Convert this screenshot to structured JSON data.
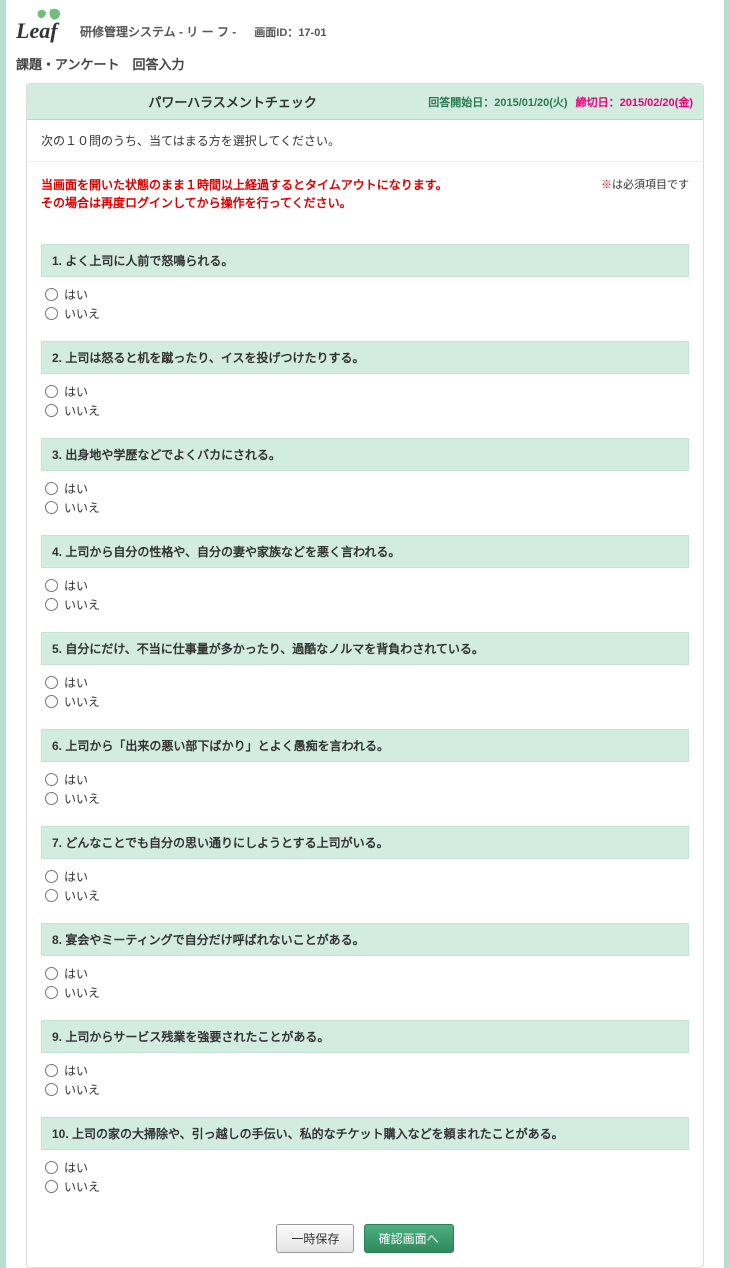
{
  "header": {
    "system_name": "研修管理システム  - リ ー フ -",
    "screen_id_label": "画面ID：",
    "screen_id": "17-01",
    "breadcrumb": "課題・アンケート　回答入力"
  },
  "titlebar": {
    "title": "パワーハラスメントチェック",
    "start_label": "回答開始日：",
    "start_value": "2015/01/20(火)",
    "deadline_label": "締切日：",
    "deadline_value": "2015/02/20(金)"
  },
  "instruction": "次の１０問のうち、当てはまる方を選択してください。",
  "timeout_warning_l1": "当画面を開いた状態のまま１時間以上経過するとタイムアウトになります。",
  "timeout_warning_l2": "その場合は再度ログインしてから操作を行ってください。",
  "required_note": "は必須項目です",
  "required_asterisk": "※",
  "option_yes": "はい",
  "option_no": "いいえ",
  "questions": [
    {
      "num": "1.",
      "text": "よく上司に人前で怒鳴られる。"
    },
    {
      "num": "2.",
      "text": "上司は怒ると机を蹴ったり、イスを投げつけたりする。"
    },
    {
      "num": "3.",
      "text": "出身地や学歴などでよくバカにされる。"
    },
    {
      "num": "4.",
      "text": "上司から自分の性格や、自分の妻や家族などを悪く言われる。"
    },
    {
      "num": "5.",
      "text": "自分にだけ、不当に仕事量が多かったり、過酷なノルマを背負わされている。"
    },
    {
      "num": "6.",
      "text": "上司から「出来の悪い部下ばかり」とよく愚痴を言われる。"
    },
    {
      "num": "7.",
      "text": "どんなことでも自分の思い通りにしようとする上司がいる。"
    },
    {
      "num": "8.",
      "text": "宴会やミーティングで自分だけ呼ばれないことがある。"
    },
    {
      "num": "9.",
      "text": "上司からサービス残業を強要されたことがある。"
    },
    {
      "num": "10.",
      "text": "上司の家の大掃除や、引っ越しの手伝い、私的なチケット購入などを頼まれたことがある。"
    }
  ],
  "buttons": {
    "save": "一時保存",
    "confirm": "確認画面へ"
  }
}
